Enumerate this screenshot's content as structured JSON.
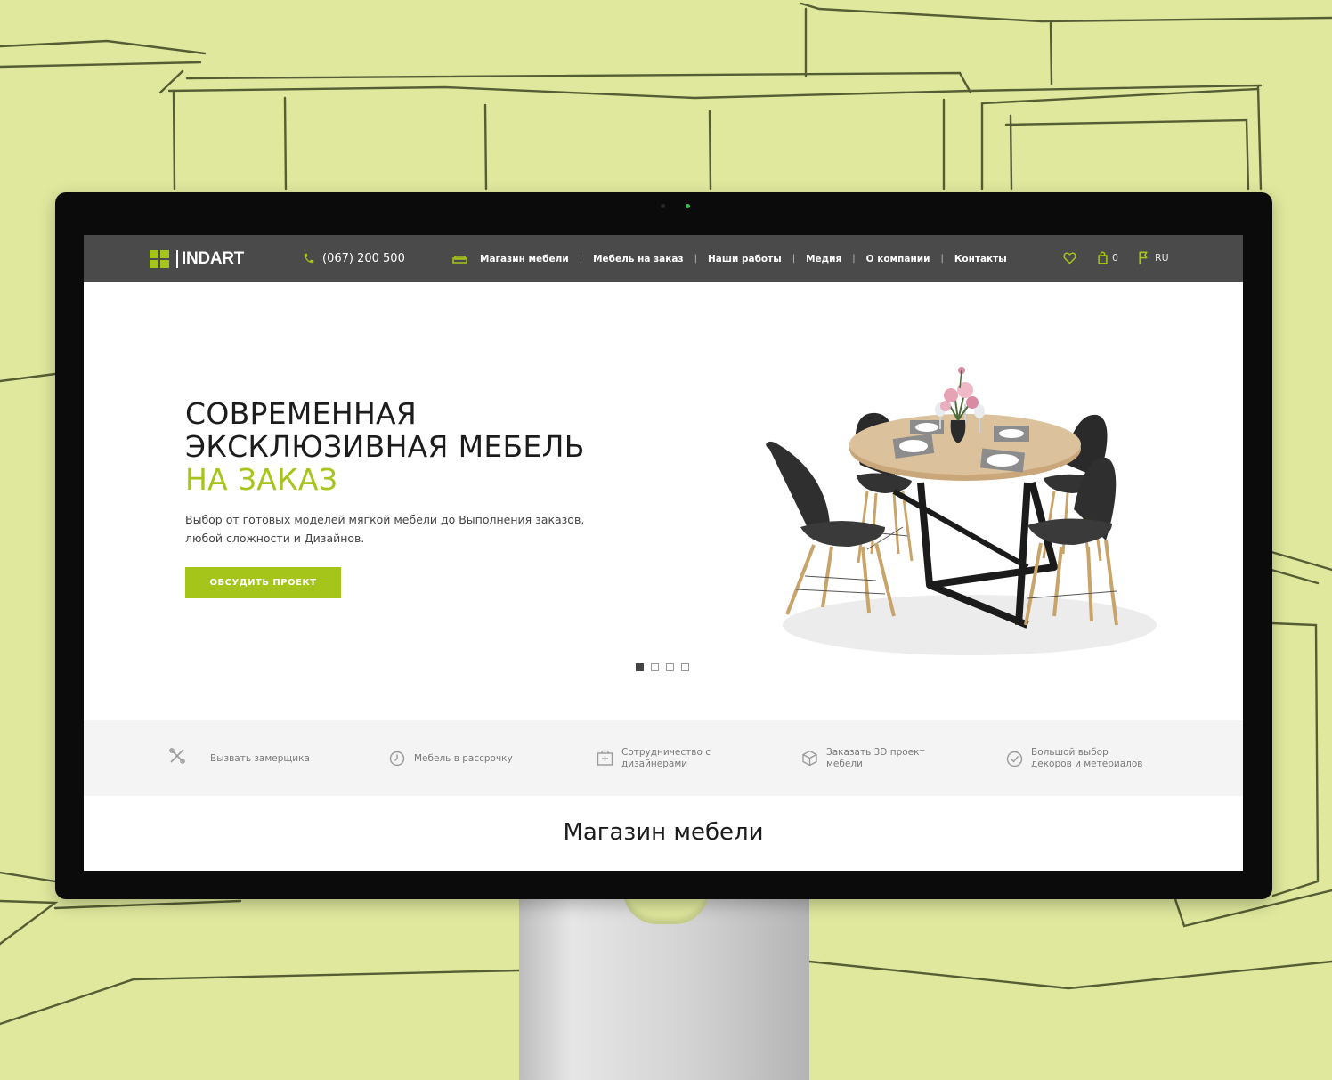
{
  "header": {
    "logo_text": "INDART",
    "phone": "(067) 200 500",
    "menu": [
      "Магазин мебели",
      "Мебель на заказ",
      "Наши работы",
      "Медия",
      "О компании",
      "Контакты"
    ],
    "separator": "|",
    "cart_count": "0",
    "language": "RU"
  },
  "hero": {
    "title_line1": "СОВРЕМЕННАЯ",
    "title_line2": "ЭКСКЛЮЗИВНАЯ МЕБЕЛЬ",
    "title_line3": "НА ЗАКАЗ",
    "subtitle_line1": "Выбор от готовых моделей мягкой мебели до Выполнения заказов,",
    "subtitle_line2": "любой сложности и Дизайнов.",
    "cta_label": "ОБСУДИТЬ ПРОЕКТ",
    "slides_total": 4,
    "slide_active": 1
  },
  "features": [
    {
      "line1": "Вызвать замерщика",
      "line2": "",
      "icon": "tools-icon"
    },
    {
      "line1": "Мебель в рассрочку",
      "line2": "",
      "icon": "clock-icon"
    },
    {
      "line1": "Сотрудничество с",
      "line2": "дизайнерами",
      "icon": "designer-icon"
    },
    {
      "line1": "Заказать 3D проект",
      "line2": "мебели",
      "icon": "cube-icon"
    },
    {
      "line1": "Большой выбор",
      "line2": "декоров и метериалов",
      "icon": "check-circle-icon"
    }
  ],
  "section_title": "Магазин мебели",
  "colors": {
    "accent": "#a6c51a",
    "header_bg": "#4a4a4a",
    "page_bg": "#dfe89d",
    "features_bg": "#f4f4f4"
  }
}
